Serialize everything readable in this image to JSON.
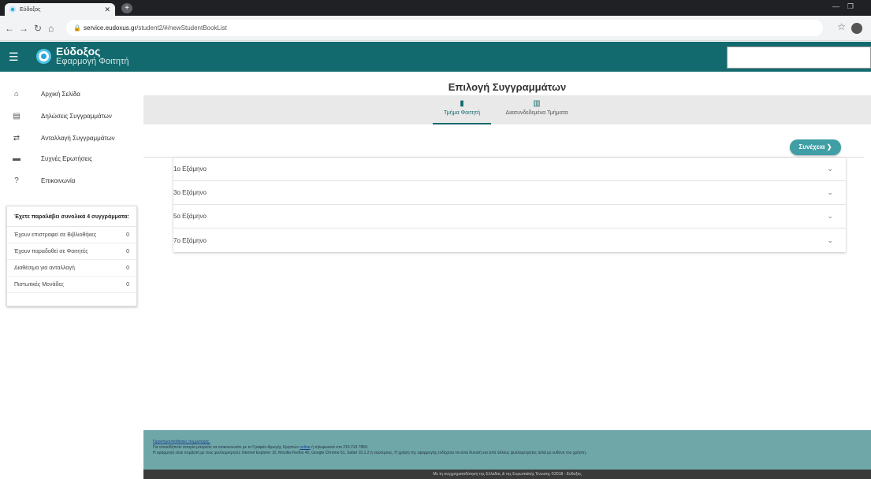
{
  "browser": {
    "tab_title": "Εύδοξος",
    "url_host": "service.eudoxus.gr",
    "url_path": "/student2/#/newStudentBookList"
  },
  "header": {
    "app_name": "Εύδοξος",
    "app_subtitle": "Εφαρμογή Φοιτητή"
  },
  "sidebar": {
    "items": [
      {
        "label": "Αρχική Σελίδα",
        "icon": "home-icon"
      },
      {
        "label": "Δηλώσεις Συγγραμμάτων",
        "icon": "list-icon"
      },
      {
        "label": "Ανταλλαγή Συγγραμμάτων",
        "icon": "exchange-icon"
      },
      {
        "label": "Συχνές Ερωτήσεις",
        "icon": "forum-icon"
      },
      {
        "label": "Επικοινωνία",
        "icon": "help-icon"
      }
    ],
    "stats": {
      "header": "Έχετε παραλάβει συνολικά 4 συγγράμματα:",
      "rows": [
        {
          "label": "Έχουν επιστραφεί σε Βιβλιοθήκες",
          "value": "0"
        },
        {
          "label": "Έχουν παραδοθεί σε Φοιτητές",
          "value": "0"
        },
        {
          "label": "Διαθέσιμα για ανταλλαγή",
          "value": "0"
        },
        {
          "label": "Πιστωτικές Μονάδες",
          "value": "0"
        }
      ]
    }
  },
  "main": {
    "title": "Επιλογή Συγγραμμάτων",
    "tabs": [
      {
        "label": "Τμήμα Φοιτητή",
        "active": true
      },
      {
        "label": "Διασυνδεδεμένα Τμήματα",
        "active": false
      }
    ],
    "continue_label": "Συνέχεια",
    "semesters": [
      "1ο Εξάμηνο",
      "3ο Εξάμηνο",
      "5ο Εξάμηνο",
      "7ο Εξάμηνο"
    ]
  },
  "footer": {
    "terms_link": "Όροι/προϋποθέσεις συμμετοχής.",
    "line1_pre": "Για οποιοδήποτε απορία μπορείτε να επικοινωνείτε με το Γραφείο Αρωγής Χρηστών",
    "line1_link": "online",
    "line1_post": "ή τηλεφωνικά στο 215 215 7850.",
    "line2": "Η εφαρμογή είναι συμβατή με τους φυλλομετρητές Internet Explorer 10, Mozilla Firefox 45, Google Chrome 61, Safari 10.1.2 ή νεώτερους. Η χρήση της εφαρμογής ενδέχεται να είναι δυνατή και από άλλους φυλλομετρητές αλλά με ευθύνη του χρήστη.",
    "copyright": "Με τη συγχρηματοδότηση της Ελλάδας & της Ευρωπαϊκής Ένωσης ©2018 - Εύδοξος"
  }
}
